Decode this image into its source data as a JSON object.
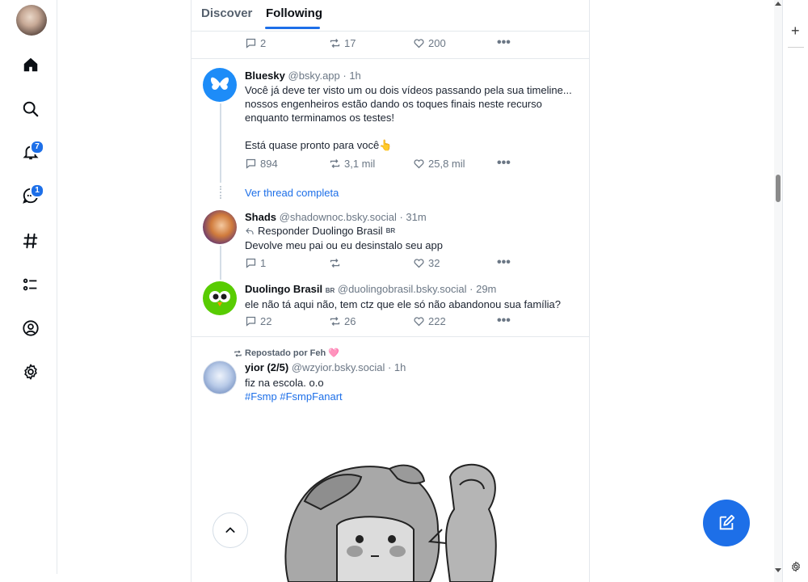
{
  "sidebar": {
    "notifications_badge": "7",
    "chat_badge": "1"
  },
  "tabs": [
    {
      "label": "Discover",
      "active": false
    },
    {
      "label": "Following",
      "active": true
    }
  ],
  "top_post_stats": {
    "replies": "2",
    "reposts": "17",
    "likes": "200"
  },
  "posts": [
    {
      "name": "Bluesky",
      "handle": "@bsky.app",
      "time": "· 1h",
      "text_lines": [
        "Você já deve ter visto um ou dois vídeos passando pela sua timeline...",
        "nossos engenheiros estão dando os toques finais neste recurso",
        "enquanto terminamos os testes!",
        "",
        "Está quase pronto para você👆"
      ],
      "replies": "894",
      "reposts": "3,1 mil",
      "likes": "25,8 mil"
    },
    {
      "name": "Shads",
      "handle": "@shadownoc.bsky.social",
      "time": "· 31m",
      "reply_to": "Responder Duolingo Brasil",
      "reply_to_flag": "BR",
      "text": "Devolve meu pai ou eu desinstalo seu app",
      "replies": "1",
      "reposts": "",
      "likes": "32"
    },
    {
      "name": "Duolingo Brasil",
      "name_flag": "BR",
      "handle": "@duolingobrasil.bsky.social",
      "time": "· 29m",
      "text": "ele não tá aqui não, tem ctz que ele só não abandonou sua família?",
      "replies": "22",
      "reposts": "26",
      "likes": "222"
    },
    {
      "repost_label": "Repostado por Feh 🩷",
      "name": "yior (2/5)",
      "handle": "@wzyior.bsky.social",
      "time": "· 1h",
      "text": "fiz na escola. o.o",
      "hashtags": "#Fsmp #FsmpFanart"
    }
  ],
  "thread_link": "Ver thread completa",
  "colors": {
    "accent": "#1d6fe8",
    "muted": "#6b7785",
    "border": "#e4e8ec"
  }
}
